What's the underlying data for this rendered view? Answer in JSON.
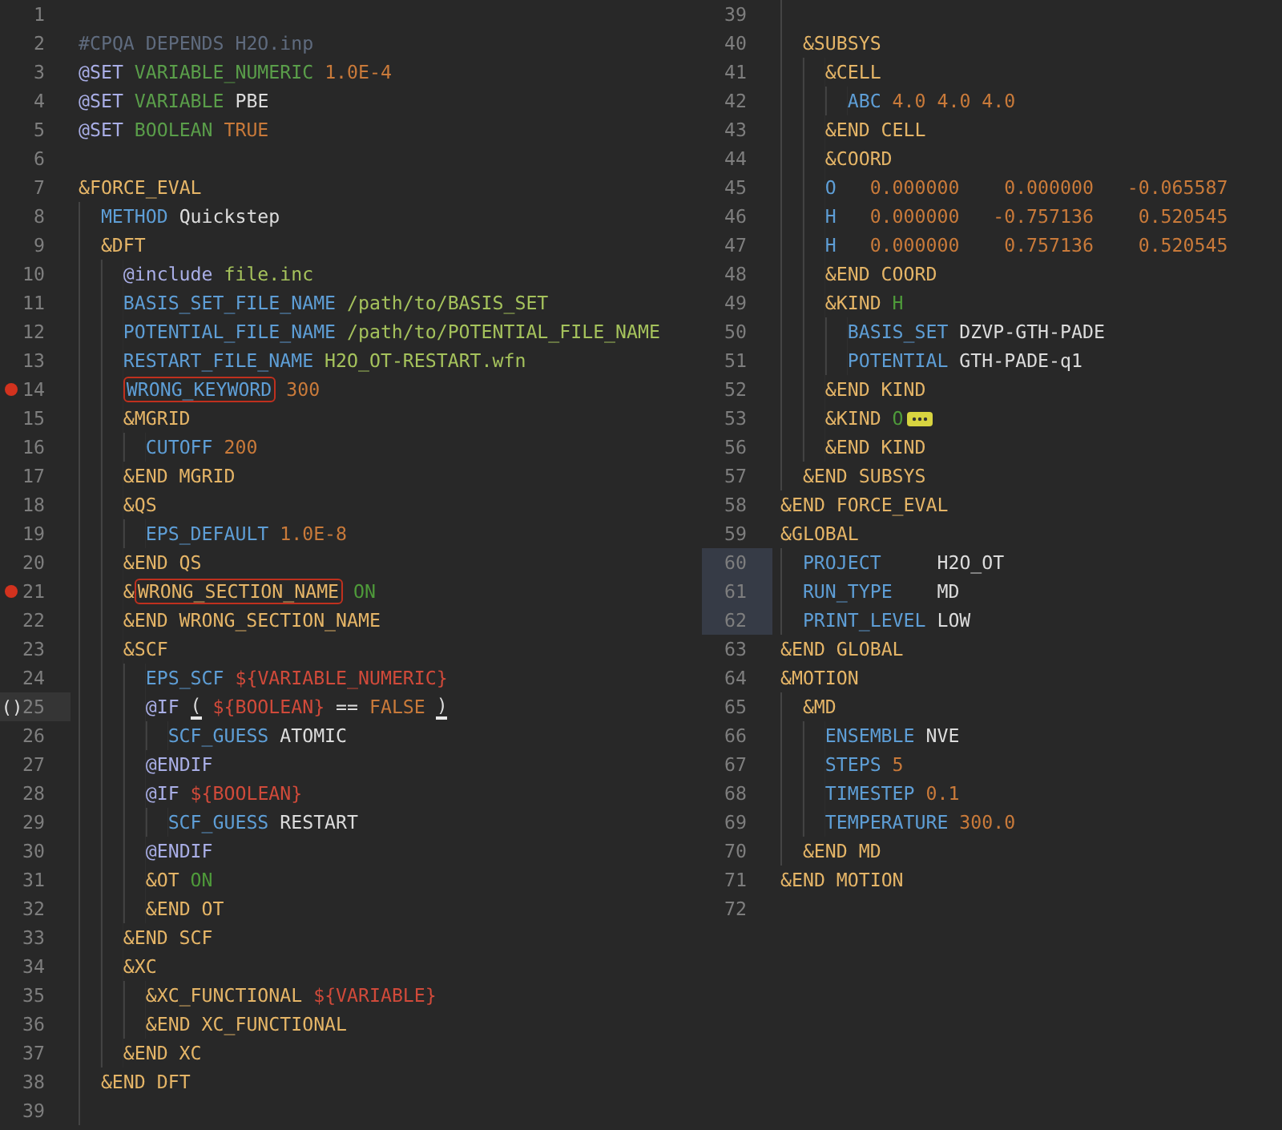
{
  "panes": [
    {
      "lines": [
        {
          "n": "1",
          "error": false,
          "selected": false
        },
        {
          "n": "2",
          "error": false,
          "selected": false,
          "t": [
            {
              "kind": "comment",
              "text": "#CPQA DEPENDS H2O.inp"
            }
          ]
        },
        {
          "n": "3",
          "error": false,
          "selected": false,
          "t": [
            {
              "kind": "directive",
              "text": "@SET"
            },
            {
              "kind": "variable",
              "text": " VARIABLE_NUMERIC"
            },
            {
              "kind": "number",
              "text": " 1.0E-4"
            }
          ]
        },
        {
          "n": "4",
          "error": false,
          "selected": false,
          "t": [
            {
              "kind": "directive",
              "text": "@SET"
            },
            {
              "kind": "variable",
              "text": " VARIABLE"
            },
            {
              "kind": "plain",
              "text": " PBE"
            }
          ]
        },
        {
          "n": "5",
          "error": false,
          "selected": false,
          "t": [
            {
              "kind": "directive",
              "text": "@SET"
            },
            {
              "kind": "variable",
              "text": " BOOLEAN"
            },
            {
              "kind": "number",
              "text": " TRUE"
            }
          ]
        },
        {
          "n": "6",
          "error": false,
          "selected": false
        },
        {
          "n": "7",
          "error": false,
          "selected": false,
          "t": [
            {
              "kind": "section",
              "text": "&FORCE_EVAL"
            }
          ]
        },
        {
          "n": "8",
          "error": false,
          "selected": false,
          "t": [
            {
              "kind": "keyword",
              "text": "  METHOD"
            },
            {
              "kind": "plain",
              "text": " Quickstep"
            }
          ]
        },
        {
          "n": "9",
          "error": false,
          "selected": false,
          "t": [
            {
              "kind": "section",
              "text": "  &DFT"
            }
          ]
        },
        {
          "n": "10",
          "error": false,
          "selected": false,
          "t": [
            {
              "kind": "directive",
              "text": "    @include"
            },
            {
              "kind": "path",
              "text": " file.inc"
            }
          ]
        },
        {
          "n": "11",
          "error": false,
          "selected": false,
          "t": [
            {
              "kind": "keyword",
              "text": "    BASIS_SET_FILE_NAME"
            },
            {
              "kind": "path",
              "text": " /path/to/BASIS_SET"
            }
          ]
        },
        {
          "n": "12",
          "error": false,
          "selected": false,
          "t": [
            {
              "kind": "keyword",
              "text": "    POTENTIAL_FILE_NAME"
            },
            {
              "kind": "path",
              "text": " /path/to/POTENTIAL_FILE_NAME"
            }
          ]
        },
        {
          "n": "13",
          "error": false,
          "selected": false,
          "t": [
            {
              "kind": "keyword",
              "text": "    RESTART_FILE_NAME"
            },
            {
              "kind": "path",
              "text": " H2O_OT-RESTART.wfn"
            }
          ]
        },
        {
          "n": "14",
          "error": true,
          "selected": false,
          "t": [
            {
              "kind": "keyword-error",
              "text": "    WRONG_KEYWORD"
            },
            {
              "kind": "number",
              "text": " 300"
            }
          ]
        },
        {
          "n": "15",
          "error": false,
          "selected": false,
          "t": [
            {
              "kind": "section",
              "text": "    &MGRID"
            }
          ]
        },
        {
          "n": "16",
          "error": false,
          "selected": false,
          "t": [
            {
              "kind": "keyword",
              "text": "      CUTOFF"
            },
            {
              "kind": "number",
              "text": " 200"
            }
          ]
        },
        {
          "n": "17",
          "error": false,
          "selected": false,
          "t": [
            {
              "kind": "section",
              "text": "    &END MGRID"
            }
          ]
        },
        {
          "n": "18",
          "error": false,
          "selected": false,
          "t": [
            {
              "kind": "section",
              "text": "    &QS"
            }
          ]
        },
        {
          "n": "19",
          "error": false,
          "selected": false,
          "t": [
            {
              "kind": "keyword",
              "text": "      EPS_DEFAULT"
            },
            {
              "kind": "number",
              "text": " 1.0E-8"
            }
          ]
        },
        {
          "n": "20",
          "error": false,
          "selected": false,
          "t": [
            {
              "kind": "section",
              "text": "    &END QS"
            }
          ]
        },
        {
          "n": "21",
          "error": true,
          "selected": false,
          "t": [
            {
              "kind": "section",
              "text": "    &"
            },
            {
              "kind": "section-error",
              "text": "WRONG_SECTION_NAME"
            },
            {
              "kind": "boolean",
              "text": " ON"
            }
          ]
        },
        {
          "n": "22",
          "error": false,
          "selected": false,
          "t": [
            {
              "kind": "section",
              "text": "    &END WRONG_SECTION_NAME"
            }
          ]
        },
        {
          "n": "23",
          "error": false,
          "selected": false,
          "t": [
            {
              "kind": "section",
              "text": "    &SCF"
            }
          ]
        },
        {
          "n": "24",
          "error": false,
          "selected": false,
          "t": [
            {
              "kind": "keyword",
              "text": "      EPS_SCF"
            },
            {
              "kind": "varref",
              "text": " ${VARIABLE_NUMERIC}"
            }
          ]
        },
        {
          "n": "25",
          "error": false,
          "selected": false,
          "marker": "()",
          "t": [
            {
              "kind": "directive",
              "text": "      @IF "
            },
            {
              "kind": "bracket",
              "text": "("
            },
            {
              "kind": "varref",
              "text": " ${BOOLEAN}"
            },
            {
              "kind": "plain",
              "text": " =="
            },
            {
              "kind": "number",
              "text": " FALSE "
            },
            {
              "kind": "bracket",
              "text": ")"
            }
          ]
        },
        {
          "n": "26",
          "error": false,
          "selected": false,
          "t": [
            {
              "kind": "keyword",
              "text": "        SCF_GUESS"
            },
            {
              "kind": "plain",
              "text": " ATOMIC"
            }
          ]
        },
        {
          "n": "27",
          "error": false,
          "selected": false,
          "t": [
            {
              "kind": "directive",
              "text": "      @ENDIF"
            }
          ]
        },
        {
          "n": "28",
          "error": false,
          "selected": false,
          "t": [
            {
              "kind": "directive",
              "text": "      @IF"
            },
            {
              "kind": "varref",
              "text": " ${BOOLEAN}"
            }
          ]
        },
        {
          "n": "29",
          "error": false,
          "selected": false,
          "t": [
            {
              "kind": "keyword",
              "text": "        SCF_GUESS"
            },
            {
              "kind": "plain",
              "text": " RESTART"
            }
          ]
        },
        {
          "n": "30",
          "error": false,
          "selected": false,
          "t": [
            {
              "kind": "directive",
              "text": "      @ENDIF"
            }
          ]
        },
        {
          "n": "31",
          "error": false,
          "selected": false,
          "t": [
            {
              "kind": "section",
              "text": "      &OT"
            },
            {
              "kind": "boolean",
              "text": " ON"
            }
          ]
        },
        {
          "n": "32",
          "error": false,
          "selected": false,
          "t": [
            {
              "kind": "section",
              "text": "      &END OT"
            }
          ]
        },
        {
          "n": "33",
          "error": false,
          "selected": false,
          "t": [
            {
              "kind": "section",
              "text": "    &END SCF"
            }
          ]
        },
        {
          "n": "34",
          "error": false,
          "selected": false,
          "t": [
            {
              "kind": "section",
              "text": "    &XC"
            }
          ]
        },
        {
          "n": "35",
          "error": false,
          "selected": false,
          "t": [
            {
              "kind": "section",
              "text": "      &XC_FUNCTIONAL"
            },
            {
              "kind": "varref",
              "text": " ${VARIABLE}"
            }
          ]
        },
        {
          "n": "36",
          "error": false,
          "selected": false,
          "t": [
            {
              "kind": "section",
              "text": "      &END XC_FUNCTIONAL"
            }
          ]
        },
        {
          "n": "37",
          "error": false,
          "selected": false,
          "t": [
            {
              "kind": "section",
              "text": "    &END XC"
            }
          ]
        },
        {
          "n": "38",
          "error": false,
          "selected": false,
          "t": [
            {
              "kind": "section",
              "text": "  &END DFT"
            }
          ]
        },
        {
          "n": "39",
          "error": false,
          "selected": false
        }
      ]
    },
    {
      "lines": [
        {
          "n": "39",
          "error": false,
          "selected": false
        },
        {
          "n": "40",
          "error": false,
          "selected": false,
          "t": [
            {
              "kind": "section",
              "text": "  &SUBSYS"
            }
          ]
        },
        {
          "n": "41",
          "error": false,
          "selected": false,
          "t": [
            {
              "kind": "section",
              "text": "    &CELL"
            }
          ]
        },
        {
          "n": "42",
          "error": false,
          "selected": false,
          "t": [
            {
              "kind": "keyword",
              "text": "      ABC"
            },
            {
              "kind": "number",
              "text": " 4.0 4.0 4.0"
            }
          ]
        },
        {
          "n": "43",
          "error": false,
          "selected": false,
          "t": [
            {
              "kind": "section",
              "text": "    &END CELL"
            }
          ]
        },
        {
          "n": "44",
          "error": false,
          "selected": false,
          "t": [
            {
              "kind": "section",
              "text": "    &COORD"
            }
          ]
        },
        {
          "n": "45",
          "error": false,
          "selected": false,
          "t": [
            {
              "kind": "keyword",
              "text": "    O"
            },
            {
              "kind": "number",
              "text": "   0.000000    0.000000   -0.065587"
            }
          ]
        },
        {
          "n": "46",
          "error": false,
          "selected": false,
          "t": [
            {
              "kind": "keyword",
              "text": "    H"
            },
            {
              "kind": "number",
              "text": "   0.000000   -0.757136    0.520545"
            }
          ]
        },
        {
          "n": "47",
          "error": false,
          "selected": false,
          "t": [
            {
              "kind": "keyword",
              "text": "    H"
            },
            {
              "kind": "number",
              "text": "   0.000000    0.757136    0.520545"
            }
          ]
        },
        {
          "n": "48",
          "error": false,
          "selected": false,
          "t": [
            {
              "kind": "section",
              "text": "    &END COORD"
            }
          ]
        },
        {
          "n": "49",
          "error": false,
          "selected": false,
          "t": [
            {
              "kind": "section",
              "text": "    &KIND"
            },
            {
              "kind": "atom",
              "text": " H"
            }
          ]
        },
        {
          "n": "50",
          "error": false,
          "selected": false,
          "t": [
            {
              "kind": "keyword",
              "text": "      BASIS_SET"
            },
            {
              "kind": "plain",
              "text": " DZVP-GTH-PADE"
            }
          ]
        },
        {
          "n": "51",
          "error": false,
          "selected": false,
          "t": [
            {
              "kind": "keyword",
              "text": "      POTENTIAL"
            },
            {
              "kind": "plain",
              "text": " GTH-PADE-q1"
            }
          ]
        },
        {
          "n": "52",
          "error": false,
          "selected": false,
          "t": [
            {
              "kind": "section",
              "text": "    &END KIND"
            }
          ]
        },
        {
          "n": "53",
          "error": false,
          "selected": false,
          "t": [
            {
              "kind": "section",
              "text": "    &KIND"
            },
            {
              "kind": "atom",
              "text": " O"
            },
            {
              "kind": "fold"
            }
          ]
        },
        {
          "n": "56",
          "error": false,
          "selected": false,
          "t": [
            {
              "kind": "section",
              "text": "    &END KIND"
            }
          ]
        },
        {
          "n": "57",
          "error": false,
          "selected": false,
          "t": [
            {
              "kind": "section",
              "text": "  &END SUBSYS"
            }
          ]
        },
        {
          "n": "58",
          "error": false,
          "selected": false,
          "t": [
            {
              "kind": "section",
              "text": "&END FORCE_EVAL"
            }
          ]
        },
        {
          "n": "59",
          "error": false,
          "selected": false,
          "t": [
            {
              "kind": "section",
              "text": "&GLOBAL"
            }
          ]
        },
        {
          "n": "60",
          "error": false,
          "selected": true,
          "t": [
            {
              "kind": "keyword",
              "text": "  PROJECT"
            },
            {
              "kind": "plain",
              "text": "     H2O_OT"
            }
          ]
        },
        {
          "n": "61",
          "error": false,
          "selected": true,
          "t": [
            {
              "kind": "keyword",
              "text": "  RUN_TYPE"
            },
            {
              "kind": "plain",
              "text": "    MD"
            }
          ]
        },
        {
          "n": "62",
          "error": false,
          "selected": true,
          "t": [
            {
              "kind": "keyword",
              "text": "  PRINT_LEVEL"
            },
            {
              "kind": "plain",
              "text": " LOW"
            }
          ]
        },
        {
          "n": "63",
          "error": false,
          "selected": false,
          "t": [
            {
              "kind": "section",
              "text": "&END GLOBAL"
            }
          ]
        },
        {
          "n": "64",
          "error": false,
          "selected": false,
          "t": [
            {
              "kind": "section",
              "text": "&MOTION"
            }
          ]
        },
        {
          "n": "65",
          "error": false,
          "selected": false,
          "t": [
            {
              "kind": "section",
              "text": "  &MD"
            }
          ]
        },
        {
          "n": "66",
          "error": false,
          "selected": false,
          "t": [
            {
              "kind": "keyword",
              "text": "    ENSEMBLE"
            },
            {
              "kind": "plain",
              "text": " NVE"
            }
          ]
        },
        {
          "n": "67",
          "error": false,
          "selected": false,
          "t": [
            {
              "kind": "keyword",
              "text": "    STEPS"
            },
            {
              "kind": "number",
              "text": " 5"
            }
          ]
        },
        {
          "n": "68",
          "error": false,
          "selected": false,
          "t": [
            {
              "kind": "keyword",
              "text": "    TIMESTEP"
            },
            {
              "kind": "number",
              "text": " 0.1"
            }
          ]
        },
        {
          "n": "69",
          "error": false,
          "selected": false,
          "t": [
            {
              "kind": "keyword",
              "text": "    TEMPERATURE"
            },
            {
              "kind": "number",
              "text": " 300.0"
            }
          ]
        },
        {
          "n": "70",
          "error": false,
          "selected": false,
          "t": [
            {
              "kind": "section",
              "text": "  &END MD"
            }
          ]
        },
        {
          "n": "71",
          "error": false,
          "selected": false,
          "t": [
            {
              "kind": "section",
              "text": "&END MOTION"
            }
          ]
        },
        {
          "n": "72",
          "error": false,
          "selected": false
        }
      ]
    }
  ]
}
